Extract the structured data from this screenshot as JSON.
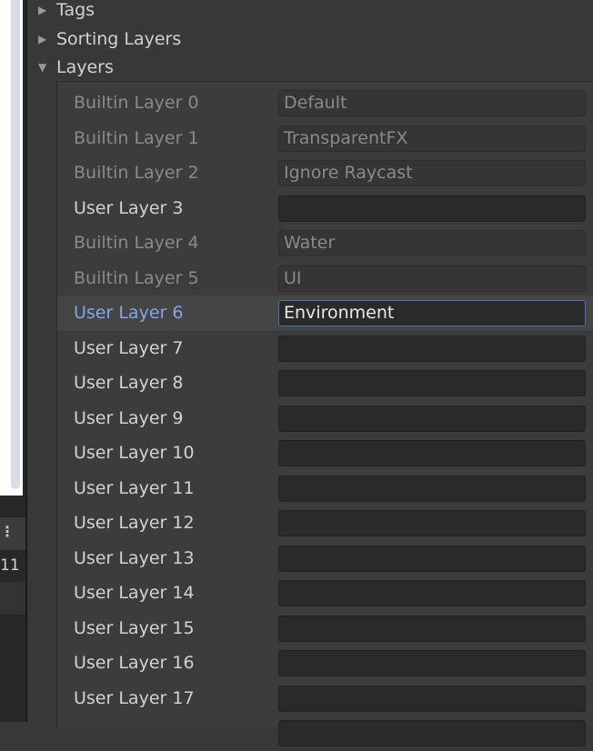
{
  "left_panel": {
    "toolbar_dots": "⋮",
    "count_text": "11"
  },
  "foldouts": [
    {
      "label": "Tags",
      "expanded": false
    },
    {
      "label": "Sorting Layers",
      "expanded": false
    },
    {
      "label": "Layers",
      "expanded": true
    }
  ],
  "layers": [
    {
      "label": "Builtin Layer 0",
      "value": "Default",
      "builtin": true
    },
    {
      "label": "Builtin Layer 1",
      "value": "TransparentFX",
      "builtin": true
    },
    {
      "label": "Builtin Layer 2",
      "value": "Ignore Raycast",
      "builtin": true
    },
    {
      "label": "User Layer 3",
      "value": "",
      "builtin": false
    },
    {
      "label": "Builtin Layer 4",
      "value": "Water",
      "builtin": true
    },
    {
      "label": "Builtin Layer 5",
      "value": "UI",
      "builtin": true
    },
    {
      "label": "User Layer 6",
      "value": "Environment",
      "builtin": false,
      "selected": true
    },
    {
      "label": "User Layer 7",
      "value": "",
      "builtin": false
    },
    {
      "label": "User Layer 8",
      "value": "",
      "builtin": false
    },
    {
      "label": "User Layer 9",
      "value": "",
      "builtin": false
    },
    {
      "label": "User Layer 10",
      "value": "",
      "builtin": false
    },
    {
      "label": "User Layer 11",
      "value": "",
      "builtin": false
    },
    {
      "label": "User Layer 12",
      "value": "",
      "builtin": false
    },
    {
      "label": "User Layer 13",
      "value": "",
      "builtin": false
    },
    {
      "label": "User Layer 14",
      "value": "",
      "builtin": false
    },
    {
      "label": "User Layer 15",
      "value": "",
      "builtin": false
    },
    {
      "label": "User Layer 16",
      "value": "",
      "builtin": false
    },
    {
      "label": "User Layer 17",
      "value": "",
      "builtin": false
    },
    {
      "label": "",
      "value": "",
      "builtin": false
    }
  ],
  "colors": {
    "selected_label": "#7fa7ea",
    "focus_border": "#3a79bb"
  },
  "icons": {
    "collapsed": "triangle-right-icon",
    "expanded": "triangle-down-icon"
  }
}
